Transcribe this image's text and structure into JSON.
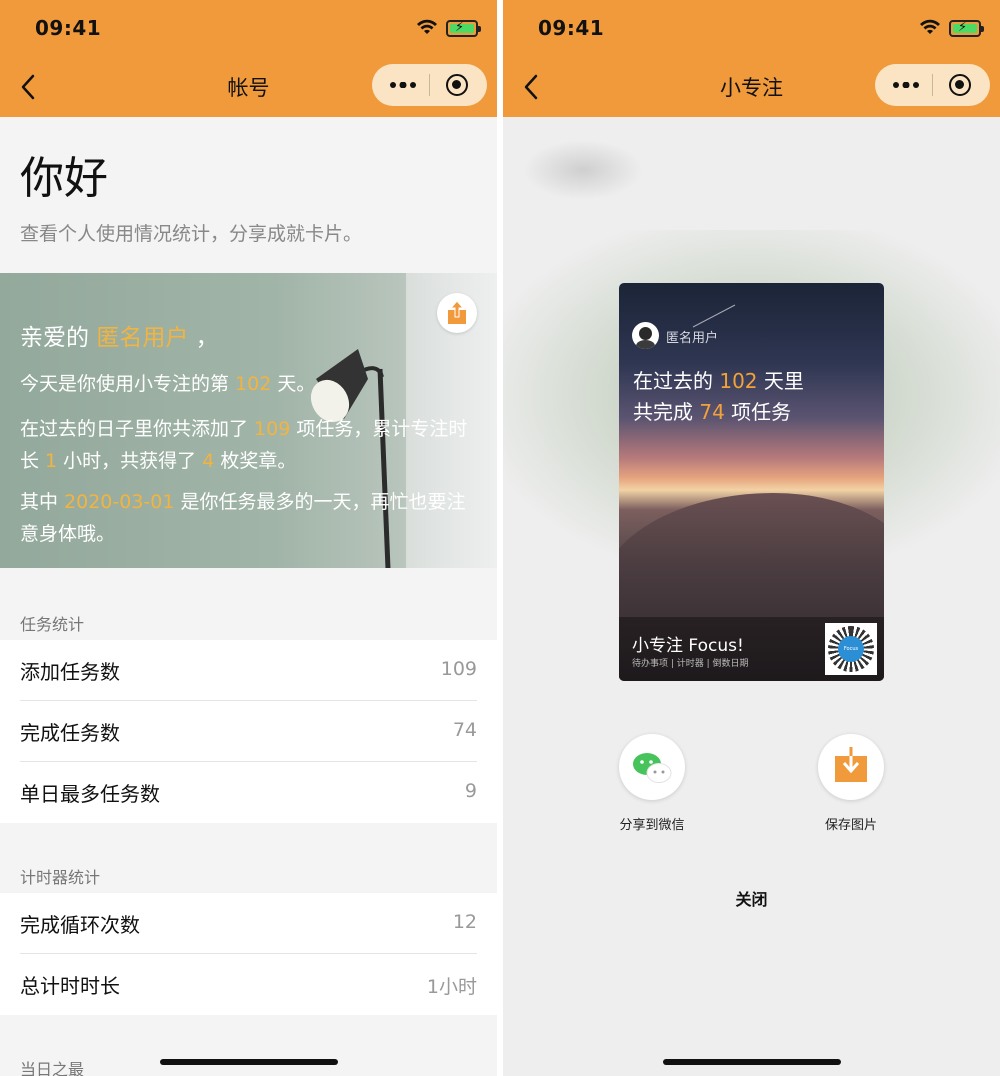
{
  "status_bar": {
    "time": "09:41"
  },
  "left": {
    "nav_title": "帐号",
    "greeting": "你好",
    "subtitle": "查看个人使用情况统计，分享成就卡片。",
    "banner": {
      "line1_prefix": "亲爱的 ",
      "user_name": "匿名用户",
      "line1_suffix": " ，",
      "line2_prefix": "今天是你使用小专注的第 ",
      "days": "102",
      "line2_suffix": " 天。",
      "line3_prefix": "在过去的日子里你共添加了 ",
      "tasks_added": "109",
      "line3_mid1": " 项任务，累计专注时长 ",
      "focus_hours": "1",
      "line3_mid2": " 小时，共获得了 ",
      "medals": "4",
      "line3_suffix": " 枚奖章。",
      "line4_prefix": "其中 ",
      "busiest_date": "2020-03-01",
      "line4_suffix": " 是你任务最多的一天，再忙也要注意身体哦。"
    },
    "task_section": {
      "title": "任务统计",
      "rows": [
        {
          "label": "添加任务数",
          "value": "109"
        },
        {
          "label": "完成任务数",
          "value": "74"
        },
        {
          "label": "单日最多任务数",
          "value": "9"
        }
      ]
    },
    "timer_section": {
      "title": "计时器统计",
      "rows": [
        {
          "label": "完成循环次数",
          "value": "12"
        },
        {
          "label": "总计时时长",
          "value": "1小时"
        }
      ]
    },
    "daily_section": {
      "title": "当日之最"
    }
  },
  "right": {
    "nav_title": "小专注",
    "poster": {
      "user_name": "匿名用户",
      "line1_prefix": "在过去的 ",
      "days": "102",
      "line1_suffix": " 天里",
      "line2_prefix": "共完成 ",
      "tasks_done": "74",
      "line2_suffix": " 项任务",
      "app_name": "小专注 Focus!",
      "tags": "待办事项  |  计时器  |  倒数日期",
      "qr_logo": "Focus"
    },
    "share_wechat_label": "分享到微信",
    "save_image_label": "保存图片",
    "close_label": "关闭"
  },
  "icons": {
    "back": "chevron-left-icon",
    "more": "more-dots-icon",
    "close_mini": "target-icon",
    "share": "share-icon",
    "wechat": "wechat-icon",
    "download": "download-icon"
  },
  "colors": {
    "accent": "#f09a3c",
    "highlight": "#f3b43f",
    "capsule": "#fbe4c3"
  }
}
